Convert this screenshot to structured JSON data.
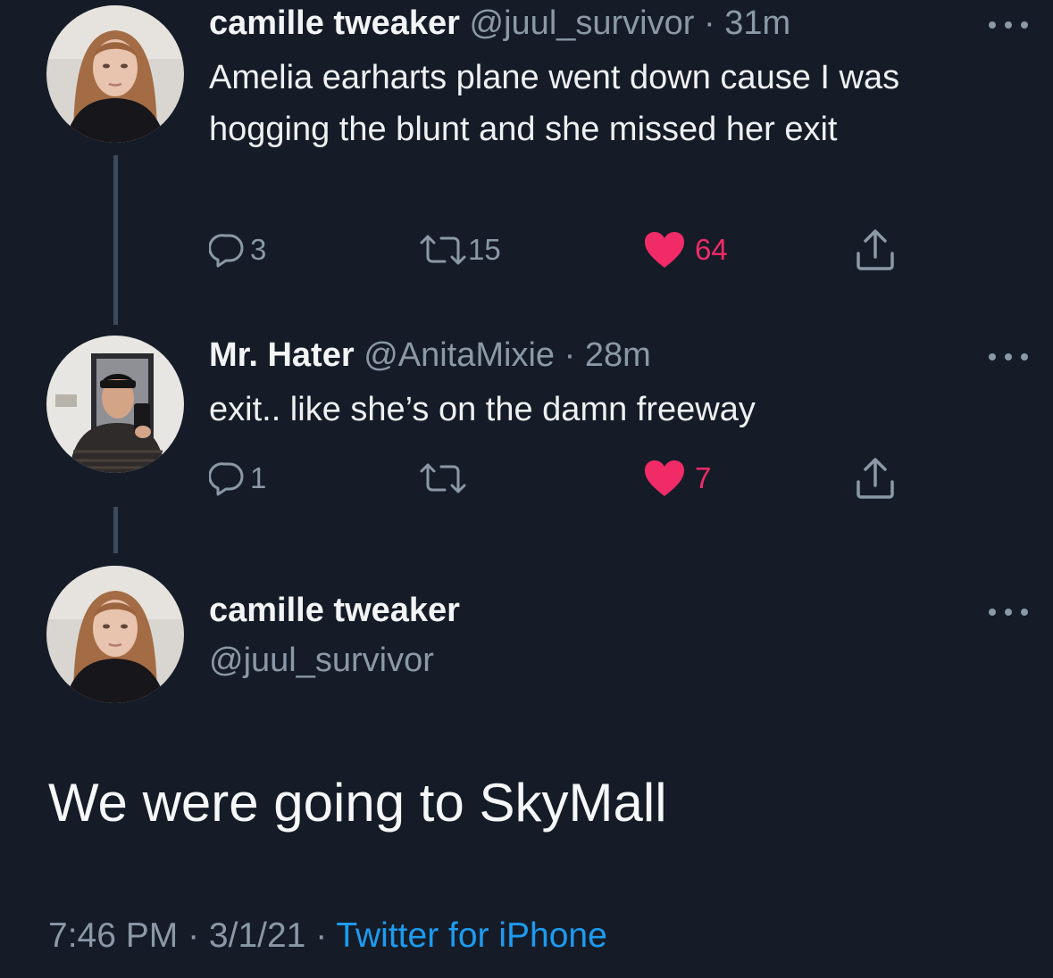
{
  "tweets": [
    {
      "display_name": "camille tweaker",
      "handle": "@juul_survivor",
      "time": "· 31m",
      "text": "Amelia earharts plane went down cause I was hogging the blunt and she missed her exit",
      "replies": "3",
      "retweets": "15",
      "likes": "64",
      "liked": true
    },
    {
      "display_name": "Mr. Hater",
      "handle": "@AnitaMixie",
      "time": "· 28m",
      "text": "exit.. like she’s on the damn freeway",
      "replies": "1",
      "retweets": "",
      "likes": "7",
      "liked": true
    }
  ],
  "main_tweet": {
    "display_name": "camille tweaker",
    "handle": "@juul_survivor",
    "text": "We were going to SkyMall",
    "time": "7:46 PM",
    "date": "3/1/21",
    "source": "Twitter for iPhone"
  },
  "icons": {
    "reply": "reply-icon",
    "retweet": "retweet-icon",
    "like": "heart-icon",
    "share": "share-icon",
    "more": "more-icon"
  },
  "colors": {
    "background": "#151c28",
    "like": "#f02b67",
    "link": "#1d9bf0",
    "secondary_text": "#8b98a5"
  }
}
